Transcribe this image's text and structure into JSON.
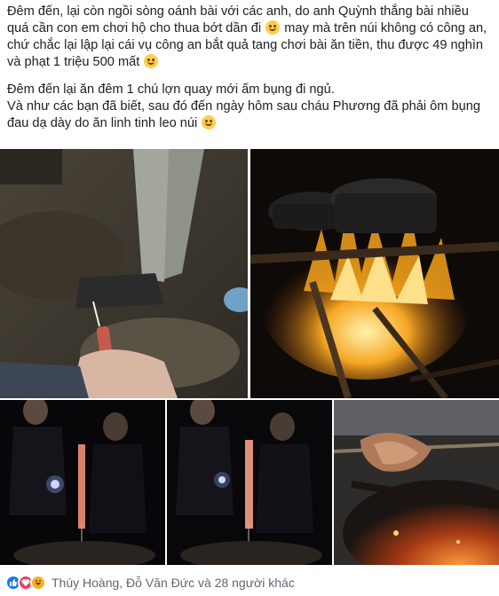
{
  "post": {
    "paragraph_1": {
      "text_a": "Đêm đến, lại còn ngồi sòng oánh bài với các anh, do anh Quỳnh thắng bài nhiều quá cần con em chơi hộ cho thua bớt dần đi",
      "text_b": "may mà trên núi không có công an, chứ chắc lại lập lại cái vụ công an bắt quả tang chơi bài ăn tiền, thu được 49 nghìn và phạt 1 triệu 500 mất"
    },
    "paragraph_2": {
      "line_1": "Đêm đến lại ăn đêm 1 chú lợn quay mới ấm bụng đi ngủ.",
      "line_2": "Và như các bạn đã biết, sau đó đến ngày hôm sau cháu Phương đã phải ôm bụng đau dạ dày do ăn linh tinh leo núi"
    },
    "emojis": [
      "sweat-smile-emoji",
      "smile-emoji",
      "smile-emoji"
    ]
  },
  "photos": [
    {
      "name": "photo-firecracker",
      "subject": "hand holding firecracker"
    },
    {
      "name": "photo-campfire-pot",
      "subject": "pot over campfire"
    },
    {
      "name": "photo-night-group-1",
      "subject": "people at night with flashlight"
    },
    {
      "name": "photo-night-group-2",
      "subject": "people at night holding meat"
    },
    {
      "name": "photo-roasting-pig",
      "subject": "roasting pig over embers"
    }
  ],
  "reactions": {
    "icons": [
      "like-icon",
      "love-icon",
      "haha-icon"
    ],
    "colors": {
      "like": "#1877f2",
      "love": "#f33e58",
      "haha": "#f7b125"
    },
    "names_text": "Thúy Hoàng, Đỗ Văn Đức và 28 người khác"
  }
}
